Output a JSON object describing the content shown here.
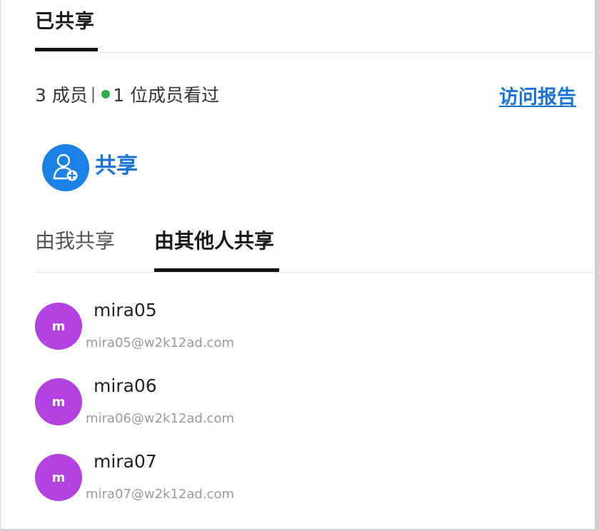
{
  "header": {
    "tab_label": "已共享"
  },
  "summary": {
    "member_count": "3 成员",
    "separator": "|",
    "viewed_text": "1 位成员看过",
    "access_report_link": "访问报告",
    "viewed_dot_color": "#2ab24a"
  },
  "share_button": {
    "label": "共享",
    "icon": "add-user-icon",
    "color": "#1a82e6"
  },
  "tabs": [
    {
      "label": "由我共享",
      "active": false
    },
    {
      "label": "由其他人共享",
      "active": true
    }
  ],
  "members": [
    {
      "initial": "m",
      "name": "mira05",
      "email": "mira05@w2k12ad.com",
      "avatar_color": "#b340e0"
    },
    {
      "initial": "m",
      "name": "mira06",
      "email": "mira06@w2k12ad.com",
      "avatar_color": "#b340e0"
    },
    {
      "initial": "m",
      "name": "mira07",
      "email": "mira07@w2k12ad.com",
      "avatar_color": "#b340e0"
    }
  ]
}
